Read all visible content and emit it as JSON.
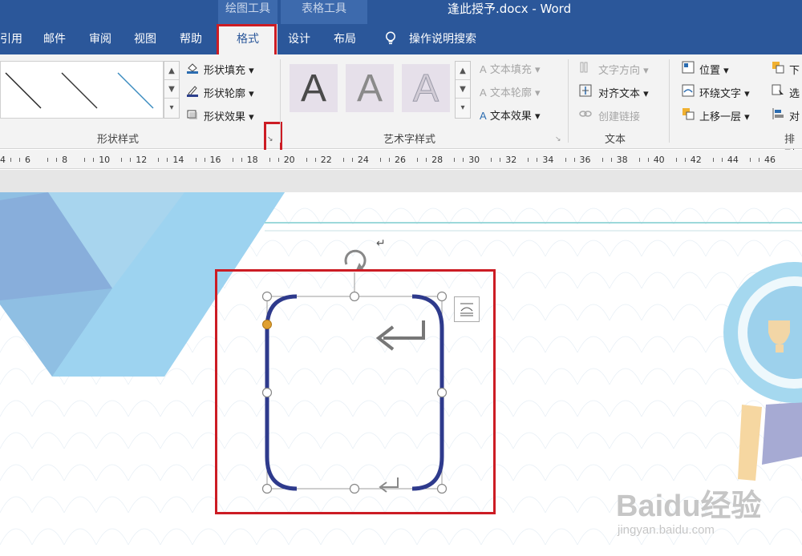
{
  "window": {
    "title": "逢此授予.docx  -  Word",
    "context_groups": [
      "绘图工具",
      "表格工具"
    ]
  },
  "tabs": [
    {
      "label": "引用",
      "active": false
    },
    {
      "label": "邮件",
      "active": false
    },
    {
      "label": "审阅",
      "active": false
    },
    {
      "label": "视图",
      "active": false
    },
    {
      "label": "帮助",
      "active": false
    },
    {
      "label": "格式",
      "active": true
    },
    {
      "label": "设计",
      "active": false
    },
    {
      "label": "布局",
      "active": false
    }
  ],
  "search": {
    "label": "操作说明搜索",
    "icon": "lightbulb-icon"
  },
  "ribbon": {
    "shape_styles": {
      "label": "形状样式",
      "fill": "形状填充",
      "outline": "形状轮廓",
      "effects": "形状效果"
    },
    "wordart_styles": {
      "label": "艺术字样式",
      "tile_letter": "A",
      "text_fill": "文本填充",
      "text_outline": "文本轮廓",
      "text_effects": "文本效果"
    },
    "text": {
      "label": "文本",
      "direction": "文字方向",
      "align": "对齐文本",
      "link": "创建链接"
    },
    "arrange": {
      "label": "排列",
      "position": "位置",
      "wrap": "环绕文字",
      "forward": "上移一层",
      "down": "下",
      "select": "选",
      "align": "对"
    }
  },
  "ruler": {
    "numbers": [
      "6",
      "8",
      "10",
      "12",
      "14",
      "16",
      "18",
      "20",
      "22",
      "24",
      "26",
      "28",
      "30",
      "32",
      "34",
      "36",
      "38",
      "40",
      "42",
      "44",
      "46"
    ],
    "left_edge": "4"
  },
  "document": {
    "paragraph_mark": "↵"
  },
  "watermark": {
    "brand": "Baidu经验",
    "url": "jingyan.baidu.com"
  },
  "colors": {
    "ribbon_blue": "#2b579a",
    "highlight_red": "#cc1c24",
    "bracket_blue": "#2e3a8c",
    "adjust_handle": "#e0a030"
  }
}
